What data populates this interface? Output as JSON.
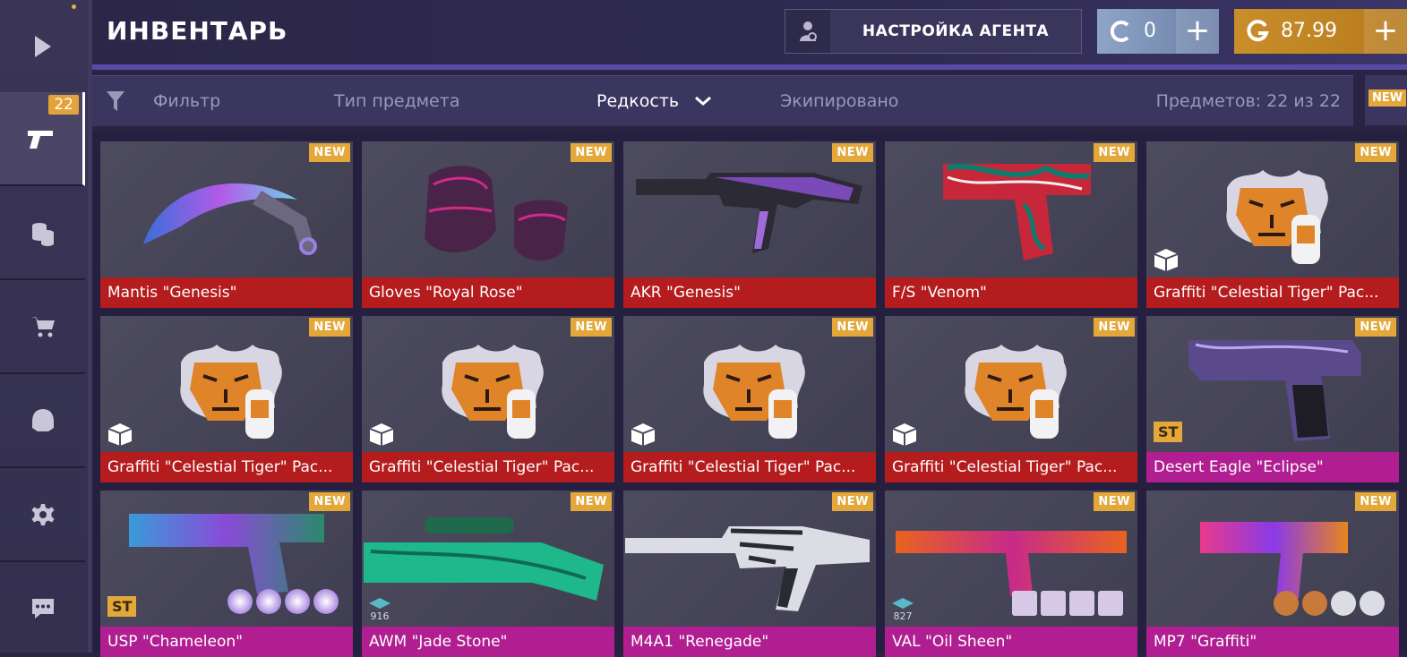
{
  "header": {
    "title": "ИНВЕНТАРЬ",
    "agent_button": "НАСТРОЙКА АГЕНТА",
    "silver": {
      "value": "0",
      "plus": "+"
    },
    "gold": {
      "value": "87.99",
      "plus": "+"
    }
  },
  "sidebar": {
    "items": [
      {
        "icon": "play-icon"
      },
      {
        "icon": "pistol-icon",
        "badge": "22"
      },
      {
        "icon": "coins-icon"
      },
      {
        "icon": "cart-icon"
      },
      {
        "icon": "helmet-icon"
      },
      {
        "icon": "gear-icon"
      },
      {
        "icon": "chat-icon"
      }
    ]
  },
  "filters": {
    "filter": "Фильтр",
    "type": "Тип предмета",
    "rarity": "Редкость",
    "equipped": "Экипировано",
    "count": "Предметов: 22 из 22",
    "side_new": "NEW"
  },
  "new_label": "NEW",
  "st_label": "ST",
  "items": [
    {
      "name": "Mantis \"Genesis\""
    },
    {
      "name": "Gloves \"Royal Rose\""
    },
    {
      "name": "AKR \"Genesis\""
    },
    {
      "name": "F/S \"Venom\""
    },
    {
      "name": "Graffiti \"Celestial Tiger\" Pac..."
    },
    {
      "name": "Graffiti \"Celestial Tiger\" Pac..."
    },
    {
      "name": "Graffiti \"Celestial Tiger\" Pac..."
    },
    {
      "name": "Graffiti \"Celestial Tiger\" Pac..."
    },
    {
      "name": "Graffiti \"Celestial Tiger\" Pac..."
    },
    {
      "name": "Desert Eagle \"Eclipse\""
    },
    {
      "name": "USP \"Chameleon\""
    },
    {
      "name": "AWM \"Jade Stone\"",
      "level": "916"
    },
    {
      "name": "M4A1 \"Renegade\""
    },
    {
      "name": "VAL \"Oil Sheen\"",
      "level": "827"
    },
    {
      "name": "MP7 \"Graffiti\""
    }
  ],
  "colors": {
    "rarity_red": "#b51c1e",
    "rarity_pink": "#b01e92",
    "badge": "#e3a73a",
    "silver": "#8fa4c8",
    "gold": "#c98e2a"
  }
}
